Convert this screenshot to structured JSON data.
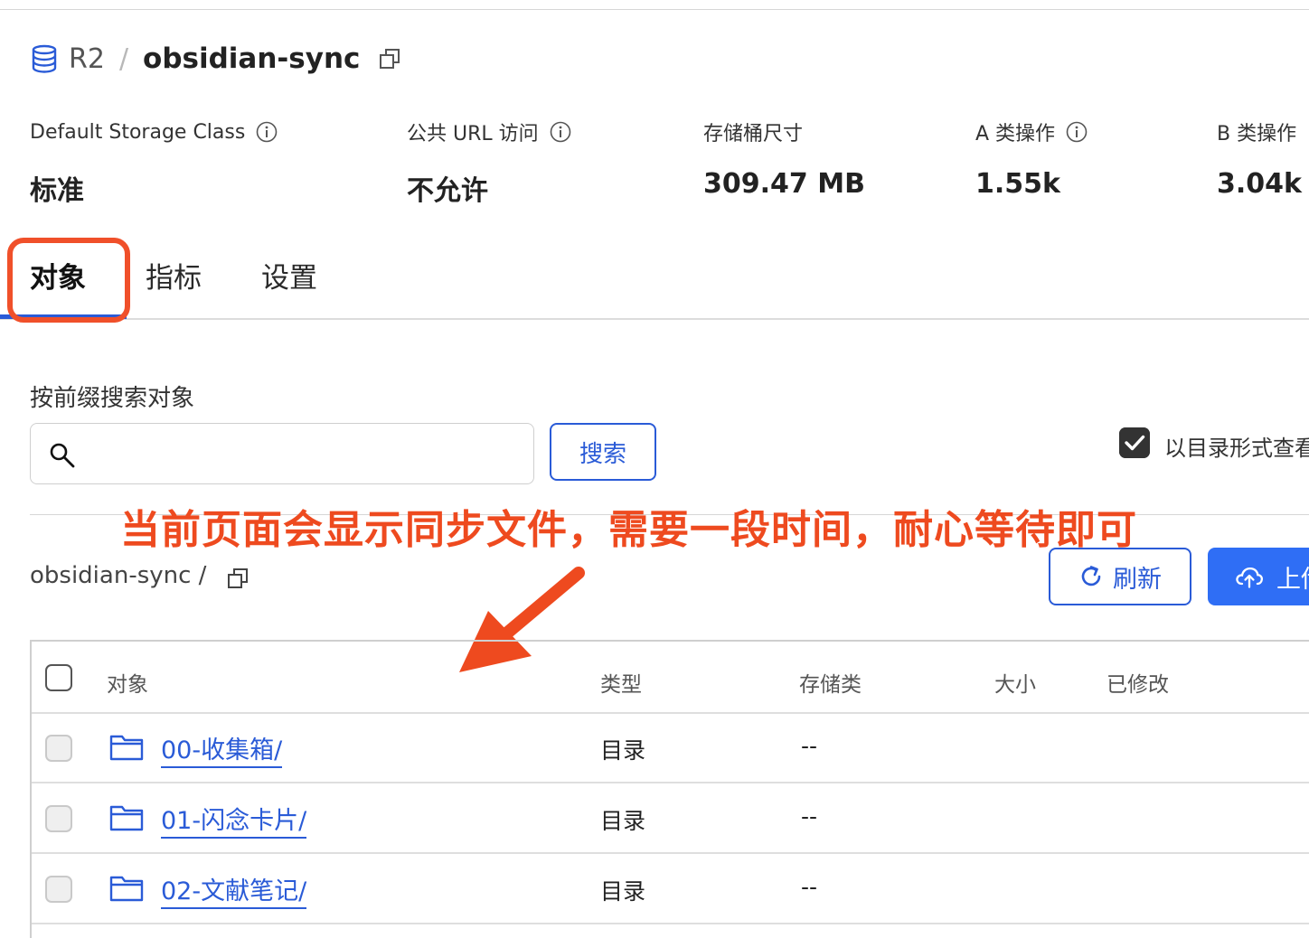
{
  "breadcrumb": {
    "service": "R2",
    "separator": "/",
    "bucket": "obsidian-sync"
  },
  "stats": [
    {
      "label": "Default Storage Class",
      "value": "标准"
    },
    {
      "label": "公共 URL 访问",
      "value": "不允许"
    },
    {
      "label": "存储桶尺寸",
      "value": "309.47 MB"
    },
    {
      "label": "A 类操作",
      "value": "1.55k"
    },
    {
      "label": "B 类操作",
      "value": "3.04k"
    }
  ],
  "tabs": [
    {
      "label": "对象",
      "active": true
    },
    {
      "label": "指标",
      "active": false
    },
    {
      "label": "设置",
      "active": false
    }
  ],
  "search": {
    "label": "按前缀搜索对象",
    "value": "",
    "button": "搜索"
  },
  "view_as_directory": {
    "label": "以目录形式查看",
    "checked": true
  },
  "annotation": "当前页面会显示同步文件，需要一段时间，耐心等待即可",
  "path": "obsidian-sync /",
  "actions": {
    "refresh": "刷新",
    "upload": "上传"
  },
  "table": {
    "columns": [
      "对象",
      "类型",
      "存储类",
      "大小",
      "已修改"
    ],
    "rows": [
      {
        "name": "00-收集箱/",
        "type": "目录",
        "storage": "--"
      },
      {
        "name": "01-闪念卡片/",
        "type": "目录",
        "storage": "--"
      },
      {
        "name": "02-文献笔记/",
        "type": "目录",
        "storage": "--"
      }
    ]
  },
  "colors": {
    "accent": "#2a5bd7",
    "primary_button": "#2f6ef5",
    "annotation": "#ee4a1f"
  },
  "icons": [
    "database-icon",
    "copy-icon",
    "info-icon",
    "search-icon",
    "checkbox-checked-icon",
    "refresh-icon",
    "cloud-upload-icon",
    "folder-icon"
  ]
}
